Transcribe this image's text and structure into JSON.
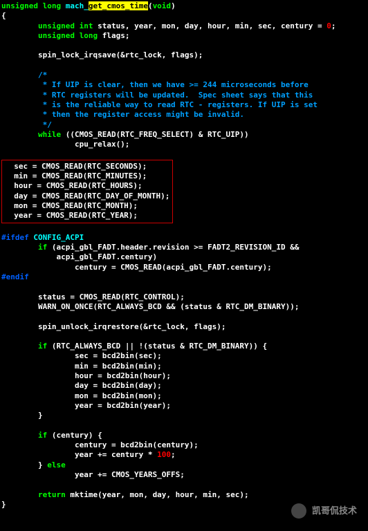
{
  "sig": {
    "ret_type": "unsigned long",
    "name_pre": "mach_",
    "name_hl": "get_cmos_time",
    "params": "void"
  },
  "decl": {
    "uint": "unsigned int",
    "vars1": " status, year, mon, day, hour, min, sec, century = ",
    "zero": "0",
    "semi": ";",
    "ulong": "unsigned long",
    "vars2": " flags;"
  },
  "spinlock": "        spin_lock_irqsave(&rtc_lock, flags);",
  "comment": {
    "l1": "        /*",
    "l2": "         * If UIP is clear, then we have >= 244 microseconds before",
    "l3": "         * RTC registers will be updated.  Spec sheet says that this",
    "l4": "         * is the reliable way to read RTC - registers. If UIP is set",
    "l5": "         * then the register access might be invalid.",
    "l6": "         */"
  },
  "while": {
    "kw": "while",
    "cond": " ((CMOS_READ(RTC_FREQ_SELECT) & RTC_UIP))",
    "body": "                cpu_relax();"
  },
  "box": {
    "l1": "  sec = CMOS_READ(RTC_SECONDS);",
    "l2": "  min = CMOS_READ(RTC_MINUTES);",
    "l3": "  hour = CMOS_READ(RTC_HOURS);",
    "l4": "  day = CMOS_READ(RTC_DAY_OF_MONTH);",
    "l5": "  mon = CMOS_READ(RTC_MONTH);",
    "l6": "  year = CMOS_READ(RTC_YEAR);"
  },
  "pp": {
    "ifdef": "#ifdef",
    "config": " CONFIG_ACPI",
    "endif": "#endif"
  },
  "acpi": {
    "if_kw": "if",
    "cond": " (acpi_gbl_FADT.header.revision >= FADT2_REVISION_ID &&",
    "cond2": "            acpi_gbl_FADT.century)",
    "body": "                century = CMOS_READ(acpi_gbl_FADT.century);"
  },
  "status_line": "        status = CMOS_READ(RTC_CONTROL);",
  "warn_line": "        WARN_ON_ONCE(RTC_ALWAYS_BCD && (status & RTC_DM_BINARY));",
  "unlock": "        spin_unlock_irqrestore(&rtc_lock, flags);",
  "bcd": {
    "if_kw": "if",
    "cond": " (RTC_ALWAYS_BCD || !(status & RTC_DM_BINARY)) {",
    "l1": "                sec = bcd2bin(sec);",
    "l2": "                min = bcd2bin(min);",
    "l3": "                hour = bcd2bin(hour);",
    "l4": "                day = bcd2bin(day);",
    "l5": "                mon = bcd2bin(mon);",
    "l6": "                year = bcd2bin(year);",
    "close": "        }"
  },
  "century": {
    "if_kw": "if",
    "cond": " (century) {",
    "l1": "                century = bcd2bin(century);",
    "l2a": "                year += century * ",
    "hundred": "100",
    "l2b": ";",
    "else_pre": "        } ",
    "else_kw": "else",
    "l3": "                year += CMOS_YEARS_OFFS;"
  },
  "ret": {
    "kw": "return",
    "body": " mktime(year, mon, day, hour, min, sec);"
  },
  "brace_open": "{",
  "brace_close": "}",
  "watermark": "凯哥侃技术"
}
